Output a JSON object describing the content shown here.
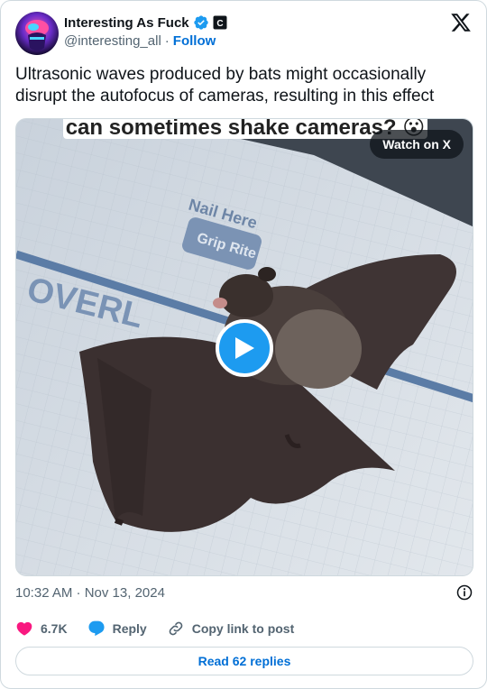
{
  "author": {
    "display_name": "Interesting As Fuck",
    "handle": "@interesting_all",
    "separator": "·",
    "follow_label": "Follow",
    "affiliate_badge": "C"
  },
  "tweet": {
    "text": "Ultrasonic waves produced by bats might occasionally disrupt the autofocus of cameras, resulting in this effect"
  },
  "media": {
    "caption_overlay": "can sometimes shake cameras? 😮",
    "watch_label": "Watch on X",
    "surface_text_1": "Nail Here",
    "surface_text_2": "Grip Rite",
    "surface_text_3": "OVERL"
  },
  "meta": {
    "timestamp": "10:32 AM · Nov 13, 2024"
  },
  "actions": {
    "like_count": "6.7K",
    "reply_label": "Reply",
    "copy_label": "Copy link to post"
  },
  "footer": {
    "read_replies_label": "Read 62 replies"
  },
  "colors": {
    "accent": "#1d9bf0",
    "link": "#006fd6",
    "like": "#f91880",
    "muted": "#536471"
  }
}
